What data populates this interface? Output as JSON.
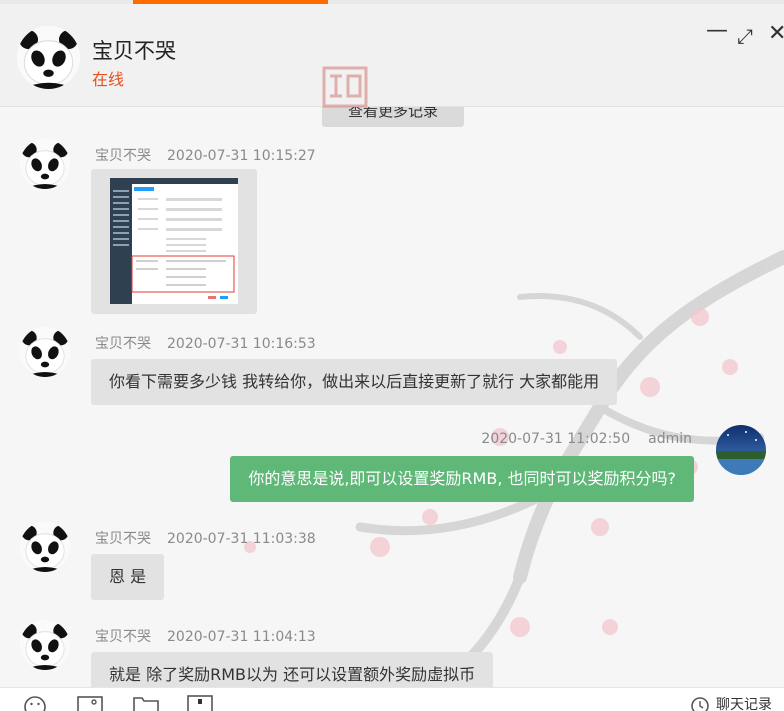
{
  "window": {
    "contact_name": "宝贝不哭",
    "contact_status": "在线",
    "minimize_glyph": "—",
    "maximize_glyph": "⤢",
    "close_glyph": "✕"
  },
  "history": {
    "load_more_label": "查看更多记录"
  },
  "messages": [
    {
      "sender": "宝贝不哭",
      "time": "2020-07-31 10:15:27",
      "type": "image"
    },
    {
      "sender": "宝贝不哭",
      "time": "2020-07-31 10:16:53",
      "type": "text",
      "text": "你看下需要多少钱 我转给你，做出来以后直接更新了就行 大家都能用"
    },
    {
      "sender": "admin",
      "time": "2020-07-31 11:02:50",
      "type": "text",
      "text": "你的意思是说,即可以设置奖励RMB, 也同时可以奖励积分吗?"
    },
    {
      "sender": "宝贝不哭",
      "time": "2020-07-31 11:03:38",
      "type": "text",
      "text": "恩 是"
    },
    {
      "sender": "宝贝不哭",
      "time": "2020-07-31 11:04:13",
      "type": "text",
      "text": "就是 除了奖励RMB以为 还可以设置额外奖励虚拟币"
    }
  ],
  "toolbar": {
    "history_label": "聊天记录"
  },
  "colors": {
    "accent": "#ff6a00",
    "status": "#e8501d",
    "self_bubble": "#5fb878",
    "other_bubble": "#e2e2e2"
  }
}
